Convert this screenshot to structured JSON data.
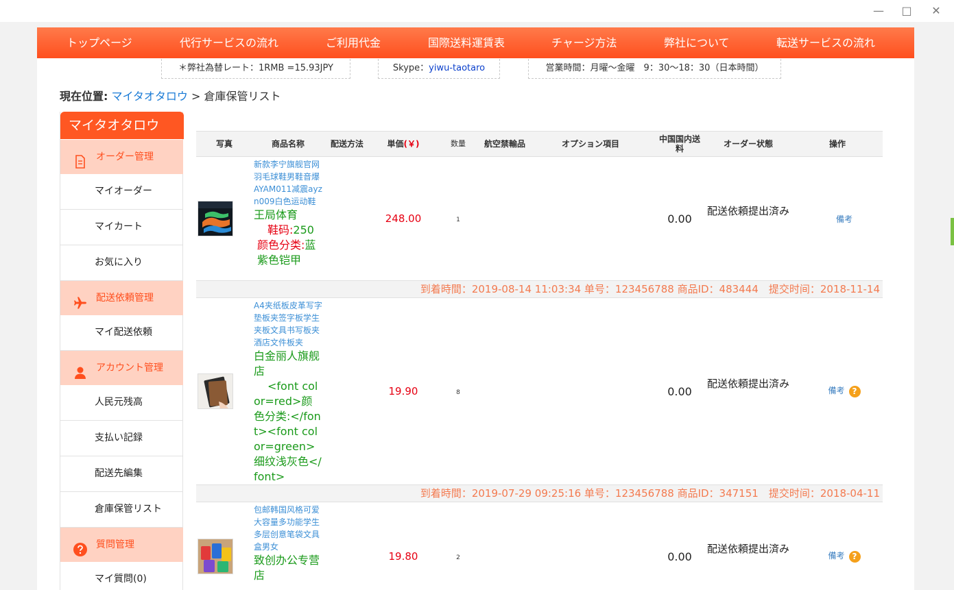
{
  "window": {
    "minimize": "—",
    "maximize": "□",
    "close": "✕"
  },
  "nav": {
    "items": [
      "トップページ",
      "代行サービスの流れ",
      "ご利用代金",
      "国際送料運賃表",
      "チャージ方法",
      "弊社について",
      "転送サービスの流れ"
    ]
  },
  "info": {
    "rate": "＊弊社為替レート：1RMB =15.93JPY",
    "skype_label": "Skype：",
    "skype_id": "yiwu-taotaro",
    "hours": "営業時間：月曜～金曜　9：30～18：30（日本時間）"
  },
  "breadcrumb": {
    "label": "現在位置:",
    "link": "マイタオタロウ",
    "separator": ">",
    "current": "倉庫保管リスト"
  },
  "sidebar": {
    "title": "マイタオタロウ",
    "sections": [
      {
        "label": "オーダー管理",
        "icon": "document-icon",
        "items": [
          "マイオーダー",
          "マイカート",
          "お気に入り"
        ]
      },
      {
        "label": "配送依頼管理",
        "icon": "airplane-icon",
        "items": [
          "マイ配送依頼"
        ]
      },
      {
        "label": "アカウント管理",
        "icon": "user-icon",
        "items": [
          "人民元残高",
          "支払い記録",
          "配送先編集",
          "倉庫保管リスト"
        ]
      },
      {
        "label": "質問管理",
        "icon": "question-icon",
        "items": [
          "マイ質問(0)"
        ]
      }
    ]
  },
  "table": {
    "headers": {
      "photo": "写真",
      "name": "商品名称",
      "shipping": "配送方法",
      "price_label": "単価",
      "price_unit": "(￥)",
      "qty": "数量",
      "prohibited": "航空禁輸品",
      "options": "オプション項目",
      "domestic_fee_1": "中国国内送",
      "domestic_fee_2": "料",
      "status": "オーダー状態",
      "action": "操作"
    },
    "rows": [
      {
        "title": "新款李宁旗舰官网羽毛球鞋男鞋音爆AYAM011减震ayzn009白色运动鞋",
        "shop": "王局体育",
        "opt1_key": "鞋码:",
        "opt1_val": "250",
        "opt2_key": "颜色分类:",
        "opt2_val": "蓝紫色铠甲",
        "price": "248.00",
        "qty": "1",
        "fee": "0.00",
        "status": "配送依頼提出済み",
        "remark": "備考"
      },
      {
        "title": "A4夹纸板皮革写字垫板夹签字板学生夹板文具书写板夹酒店文件板夹",
        "shop": "白金丽人旗舰店",
        "opt_raw": "<font color=red>颜色分类:</font><font color=green>细纹浅灰色</font>",
        "price": "19.90",
        "qty": "8",
        "fee": "0.00",
        "status": "配送依頼提出済み",
        "remark": "備考",
        "help": "?"
      },
      {
        "title": "包邮韩国风格可爱大容量多功能学生多层创意笔袋文具盒男女",
        "shop": "致创办公专营店",
        "price": "19.80",
        "qty": "2",
        "fee": "0.00",
        "status": "配送依頼提出済み",
        "remark": "備考",
        "help": "?"
      }
    ],
    "meta": [
      "到着時間：2019-08-14 11:03:34 单号：123456788 商品ID：483444　提交时间：2018-11-14",
      "到着時間：2019-07-29 09:25:16 单号：123456788 商品ID：347151　提交时间：2018-04-11"
    ]
  },
  "colors": {
    "accent": "#ff5722",
    "category_bg": "#ffd2c2",
    "price": "#e60012",
    "meta": "#f37a4f",
    "link": "#3c8fd6"
  }
}
